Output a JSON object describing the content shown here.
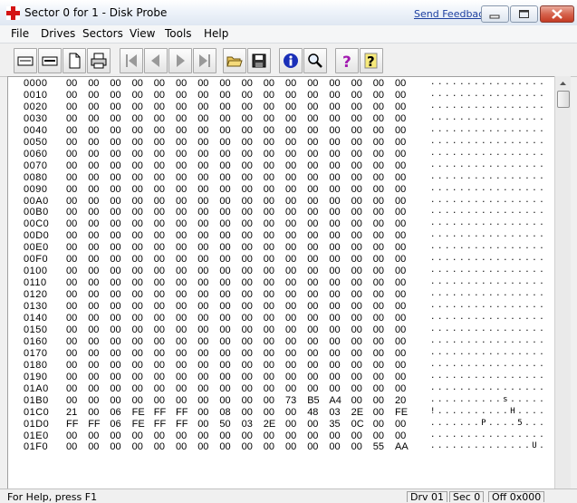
{
  "window": {
    "title": "Sector 0 for 1 - Disk Probe",
    "send_feedback": "Send Feedback",
    "icon": "red-cross-icon"
  },
  "menu": [
    "File",
    "Drives",
    "Sectors",
    "View",
    "Tools",
    "Help"
  ],
  "toolbar": {
    "buttons": [
      "read-sector-icon",
      "write-sector-icon",
      "document-icon",
      "print-icon",
      "first-sector-icon",
      "prev-sector-icon",
      "next-sector-icon",
      "last-sector-icon",
      "open-folder-icon",
      "save-icon",
      "info-icon",
      "find-icon",
      "help-icon",
      "context-help-icon"
    ]
  },
  "hex": {
    "rows": [
      {
        "addr": "0000",
        "bytes": [
          "00",
          "00",
          "00",
          "00",
          "00",
          "00",
          "00",
          "00",
          "00",
          "00",
          "00",
          "00",
          "00",
          "00",
          "00",
          "00"
        ],
        "ascii": "................"
      },
      {
        "addr": "0010",
        "bytes": [
          "00",
          "00",
          "00",
          "00",
          "00",
          "00",
          "00",
          "00",
          "00",
          "00",
          "00",
          "00",
          "00",
          "00",
          "00",
          "00"
        ],
        "ascii": "................"
      },
      {
        "addr": "0020",
        "bytes": [
          "00",
          "00",
          "00",
          "00",
          "00",
          "00",
          "00",
          "00",
          "00",
          "00",
          "00",
          "00",
          "00",
          "00",
          "00",
          "00"
        ],
        "ascii": "................"
      },
      {
        "addr": "0030",
        "bytes": [
          "00",
          "00",
          "00",
          "00",
          "00",
          "00",
          "00",
          "00",
          "00",
          "00",
          "00",
          "00",
          "00",
          "00",
          "00",
          "00"
        ],
        "ascii": "................"
      },
      {
        "addr": "0040",
        "bytes": [
          "00",
          "00",
          "00",
          "00",
          "00",
          "00",
          "00",
          "00",
          "00",
          "00",
          "00",
          "00",
          "00",
          "00",
          "00",
          "00"
        ],
        "ascii": "................"
      },
      {
        "addr": "0050",
        "bytes": [
          "00",
          "00",
          "00",
          "00",
          "00",
          "00",
          "00",
          "00",
          "00",
          "00",
          "00",
          "00",
          "00",
          "00",
          "00",
          "00"
        ],
        "ascii": "................"
      },
      {
        "addr": "0060",
        "bytes": [
          "00",
          "00",
          "00",
          "00",
          "00",
          "00",
          "00",
          "00",
          "00",
          "00",
          "00",
          "00",
          "00",
          "00",
          "00",
          "00"
        ],
        "ascii": "................"
      },
      {
        "addr": "0070",
        "bytes": [
          "00",
          "00",
          "00",
          "00",
          "00",
          "00",
          "00",
          "00",
          "00",
          "00",
          "00",
          "00",
          "00",
          "00",
          "00",
          "00"
        ],
        "ascii": "................"
      },
      {
        "addr": "0080",
        "bytes": [
          "00",
          "00",
          "00",
          "00",
          "00",
          "00",
          "00",
          "00",
          "00",
          "00",
          "00",
          "00",
          "00",
          "00",
          "00",
          "00"
        ],
        "ascii": "................"
      },
      {
        "addr": "0090",
        "bytes": [
          "00",
          "00",
          "00",
          "00",
          "00",
          "00",
          "00",
          "00",
          "00",
          "00",
          "00",
          "00",
          "00",
          "00",
          "00",
          "00"
        ],
        "ascii": "................"
      },
      {
        "addr": "00A0",
        "bytes": [
          "00",
          "00",
          "00",
          "00",
          "00",
          "00",
          "00",
          "00",
          "00",
          "00",
          "00",
          "00",
          "00",
          "00",
          "00",
          "00"
        ],
        "ascii": "................"
      },
      {
        "addr": "00B0",
        "bytes": [
          "00",
          "00",
          "00",
          "00",
          "00",
          "00",
          "00",
          "00",
          "00",
          "00",
          "00",
          "00",
          "00",
          "00",
          "00",
          "00"
        ],
        "ascii": "................"
      },
      {
        "addr": "00C0",
        "bytes": [
          "00",
          "00",
          "00",
          "00",
          "00",
          "00",
          "00",
          "00",
          "00",
          "00",
          "00",
          "00",
          "00",
          "00",
          "00",
          "00"
        ],
        "ascii": "................"
      },
      {
        "addr": "00D0",
        "bytes": [
          "00",
          "00",
          "00",
          "00",
          "00",
          "00",
          "00",
          "00",
          "00",
          "00",
          "00",
          "00",
          "00",
          "00",
          "00",
          "00"
        ],
        "ascii": "................"
      },
      {
        "addr": "00E0",
        "bytes": [
          "00",
          "00",
          "00",
          "00",
          "00",
          "00",
          "00",
          "00",
          "00",
          "00",
          "00",
          "00",
          "00",
          "00",
          "00",
          "00"
        ],
        "ascii": "................"
      },
      {
        "addr": "00F0",
        "bytes": [
          "00",
          "00",
          "00",
          "00",
          "00",
          "00",
          "00",
          "00",
          "00",
          "00",
          "00",
          "00",
          "00",
          "00",
          "00",
          "00"
        ],
        "ascii": "................"
      },
      {
        "addr": "0100",
        "bytes": [
          "00",
          "00",
          "00",
          "00",
          "00",
          "00",
          "00",
          "00",
          "00",
          "00",
          "00",
          "00",
          "00",
          "00",
          "00",
          "00"
        ],
        "ascii": "................"
      },
      {
        "addr": "0110",
        "bytes": [
          "00",
          "00",
          "00",
          "00",
          "00",
          "00",
          "00",
          "00",
          "00",
          "00",
          "00",
          "00",
          "00",
          "00",
          "00",
          "00"
        ],
        "ascii": "................"
      },
      {
        "addr": "0120",
        "bytes": [
          "00",
          "00",
          "00",
          "00",
          "00",
          "00",
          "00",
          "00",
          "00",
          "00",
          "00",
          "00",
          "00",
          "00",
          "00",
          "00"
        ],
        "ascii": "................"
      },
      {
        "addr": "0130",
        "bytes": [
          "00",
          "00",
          "00",
          "00",
          "00",
          "00",
          "00",
          "00",
          "00",
          "00",
          "00",
          "00",
          "00",
          "00",
          "00",
          "00"
        ],
        "ascii": "................"
      },
      {
        "addr": "0140",
        "bytes": [
          "00",
          "00",
          "00",
          "00",
          "00",
          "00",
          "00",
          "00",
          "00",
          "00",
          "00",
          "00",
          "00",
          "00",
          "00",
          "00"
        ],
        "ascii": "................"
      },
      {
        "addr": "0150",
        "bytes": [
          "00",
          "00",
          "00",
          "00",
          "00",
          "00",
          "00",
          "00",
          "00",
          "00",
          "00",
          "00",
          "00",
          "00",
          "00",
          "00"
        ],
        "ascii": "................"
      },
      {
        "addr": "0160",
        "bytes": [
          "00",
          "00",
          "00",
          "00",
          "00",
          "00",
          "00",
          "00",
          "00",
          "00",
          "00",
          "00",
          "00",
          "00",
          "00",
          "00"
        ],
        "ascii": "................"
      },
      {
        "addr": "0170",
        "bytes": [
          "00",
          "00",
          "00",
          "00",
          "00",
          "00",
          "00",
          "00",
          "00",
          "00",
          "00",
          "00",
          "00",
          "00",
          "00",
          "00"
        ],
        "ascii": "................"
      },
      {
        "addr": "0180",
        "bytes": [
          "00",
          "00",
          "00",
          "00",
          "00",
          "00",
          "00",
          "00",
          "00",
          "00",
          "00",
          "00",
          "00",
          "00",
          "00",
          "00"
        ],
        "ascii": "................"
      },
      {
        "addr": "0190",
        "bytes": [
          "00",
          "00",
          "00",
          "00",
          "00",
          "00",
          "00",
          "00",
          "00",
          "00",
          "00",
          "00",
          "00",
          "00",
          "00",
          "00"
        ],
        "ascii": "................"
      },
      {
        "addr": "01A0",
        "bytes": [
          "00",
          "00",
          "00",
          "00",
          "00",
          "00",
          "00",
          "00",
          "00",
          "00",
          "00",
          "00",
          "00",
          "00",
          "00",
          "00"
        ],
        "ascii": "................"
      },
      {
        "addr": "01B0",
        "bytes": [
          "00",
          "00",
          "00",
          "00",
          "00",
          "00",
          "00",
          "00",
          "00",
          "00",
          "73",
          "B5",
          "A4",
          "00",
          "00",
          "20"
        ],
        "ascii": "..........s....."
      },
      {
        "addr": "01C0",
        "bytes": [
          "21",
          "00",
          "06",
          "FE",
          "FF",
          "FF",
          "00",
          "08",
          "00",
          "00",
          "00",
          "48",
          "03",
          "2E",
          "00",
          "FE"
        ],
        "ascii": "!..........H...."
      },
      {
        "addr": "01D0",
        "bytes": [
          "FF",
          "FF",
          "06",
          "FE",
          "FF",
          "FF",
          "00",
          "50",
          "03",
          "2E",
          "00",
          "00",
          "35",
          "0C",
          "00",
          "00"
        ],
        "ascii": ".......P....5..."
      },
      {
        "addr": "01E0",
        "bytes": [
          "00",
          "00",
          "00",
          "00",
          "00",
          "00",
          "00",
          "00",
          "00",
          "00",
          "00",
          "00",
          "00",
          "00",
          "00",
          "00"
        ],
        "ascii": "................"
      },
      {
        "addr": "01F0",
        "bytes": [
          "00",
          "00",
          "00",
          "00",
          "00",
          "00",
          "00",
          "00",
          "00",
          "00",
          "00",
          "00",
          "00",
          "00",
          "55",
          "AA"
        ],
        "ascii": "..............U."
      }
    ]
  },
  "status": {
    "help": "For Help, press F1",
    "drive": "Drv 01",
    "sector": "Sec 0",
    "offset": "Off 0x000"
  }
}
